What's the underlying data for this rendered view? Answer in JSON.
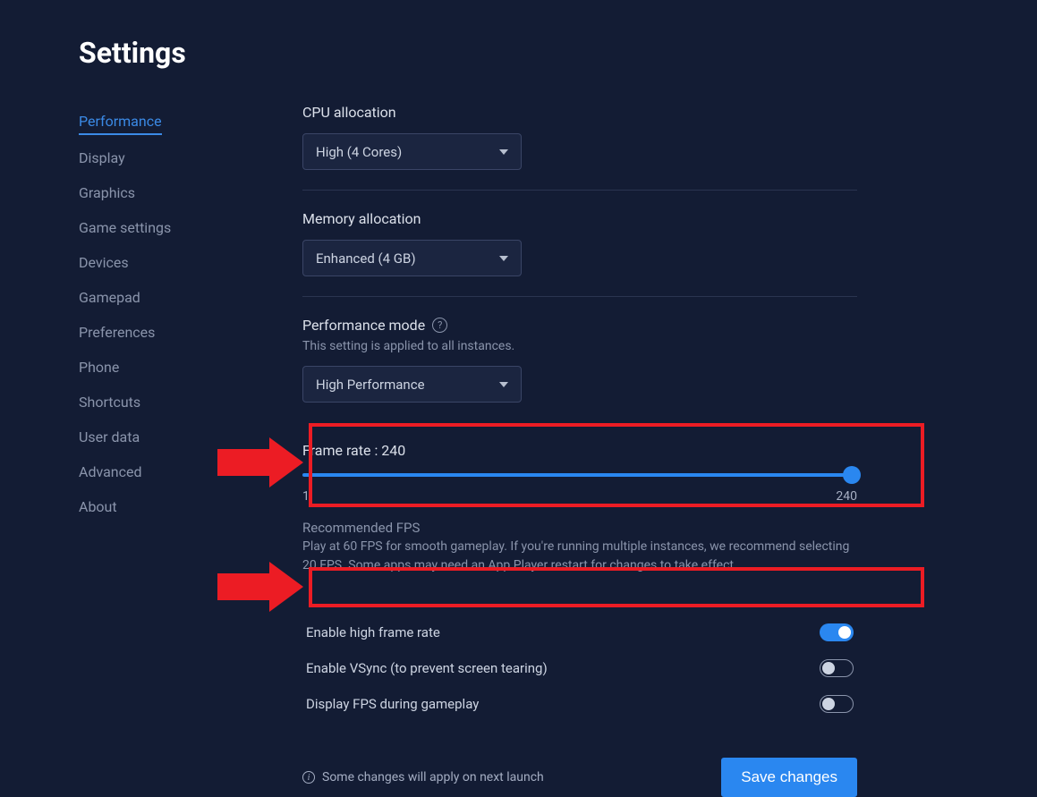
{
  "page_title": "Settings",
  "sidebar": {
    "items": [
      {
        "label": "Performance",
        "active": true
      },
      {
        "label": "Display"
      },
      {
        "label": "Graphics"
      },
      {
        "label": "Game settings"
      },
      {
        "label": "Devices"
      },
      {
        "label": "Gamepad"
      },
      {
        "label": "Preferences"
      },
      {
        "label": "Phone"
      },
      {
        "label": "Shortcuts"
      },
      {
        "label": "User data"
      },
      {
        "label": "Advanced"
      },
      {
        "label": "About"
      }
    ]
  },
  "cpu": {
    "label": "CPU allocation",
    "value": "High (4 Cores)"
  },
  "memory": {
    "label": "Memory allocation",
    "value": "Enhanced (4 GB)"
  },
  "perfmode": {
    "label": "Performance mode",
    "subtext": "This setting is applied to all instances.",
    "value": "High Performance"
  },
  "framerate": {
    "label_prefix": "Frame rate : ",
    "value": "240",
    "min": "1",
    "max": "240",
    "rec_title": "Recommended FPS",
    "rec_text": "Play at 60 FPS for smooth gameplay. If you're running multiple instances, we recommend selecting 20 FPS. Some apps may need an App Player restart for changes to take effect."
  },
  "toggles": {
    "hfr": {
      "label": "Enable high frame rate",
      "on": true
    },
    "vsync": {
      "label": "Enable VSync (to prevent screen tearing)",
      "on": false
    },
    "dfps": {
      "label": "Display FPS during gameplay",
      "on": false
    }
  },
  "footer": {
    "info": "Some changes will apply on next launch",
    "save": "Save changes"
  }
}
